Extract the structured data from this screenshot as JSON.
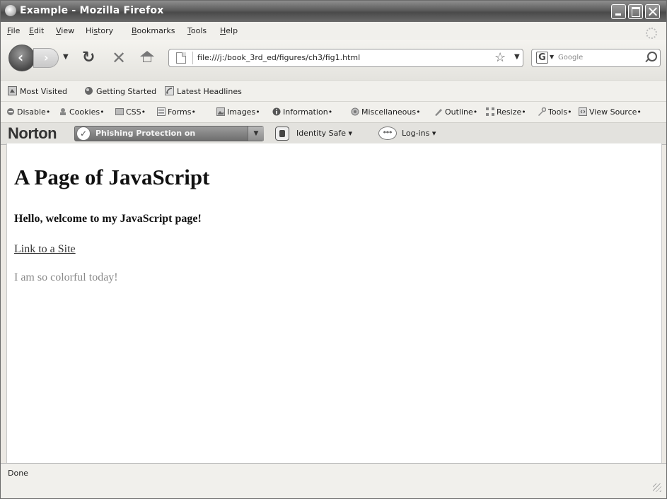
{
  "window": {
    "title": "Example - Mozilla Firefox"
  },
  "menu": {
    "items": [
      {
        "label": "File",
        "key": "F",
        "rest": "ile"
      },
      {
        "label": "Edit",
        "key": "E",
        "rest": "dit"
      },
      {
        "label": "View",
        "key": "V",
        "rest": "iew"
      },
      {
        "label": "History",
        "pre": "Hi",
        "key": "s",
        "rest": "tory"
      },
      {
        "label": "Bookmarks",
        "key": "B",
        "rest": "ookmarks"
      },
      {
        "label": "Tools",
        "key": "T",
        "rest": "ools"
      },
      {
        "label": "Help",
        "key": "H",
        "rest": "elp"
      }
    ]
  },
  "nav": {
    "url": "file:///j:/book_3rd_ed/figures/ch3/fig1.html",
    "search_placeholder": "Google"
  },
  "bookmarks": {
    "items": [
      "Most Visited",
      "Getting Started",
      "Latest Headlines"
    ]
  },
  "devtools": {
    "items": [
      "Disable",
      "Cookies",
      "CSS",
      "Forms",
      "Images",
      "Information",
      "Miscellaneous",
      "Outline",
      "Resize",
      "Tools",
      "View Source"
    ]
  },
  "norton": {
    "logo": "Norton",
    "phishing_label": "Phishing Protection on",
    "identity_safe": "Identity Safe",
    "logins": "Log-ins",
    "logins_badge": "***"
  },
  "page": {
    "heading": "A Page of JavaScript",
    "welcome": "Hello, welcome to my JavaScript page!",
    "link": "Link to a Site",
    "colorful": "I am so colorful today!"
  },
  "status": {
    "text": "Done"
  }
}
